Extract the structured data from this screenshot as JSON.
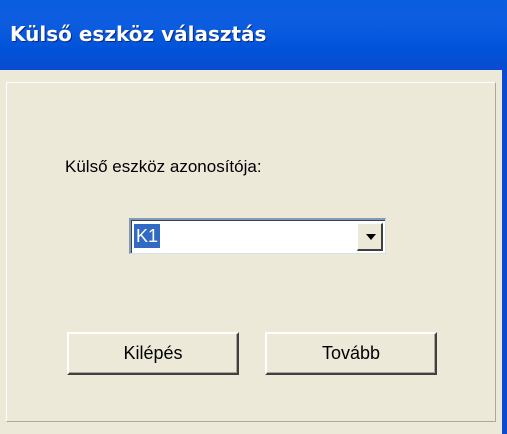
{
  "window": {
    "title": "Külső eszköz választás"
  },
  "form": {
    "device_id_label": "Külső eszköz azonosítója:",
    "device_id_value": "K1"
  },
  "buttons": {
    "exit_label": "Kilépés",
    "next_label": "Tovább"
  },
  "colors": {
    "title_bar": "#0053d9",
    "dialog_background": "#ece9d8",
    "selection": "#316ac5"
  },
  "icons": {
    "dropdown": "chevron-down-icon"
  }
}
